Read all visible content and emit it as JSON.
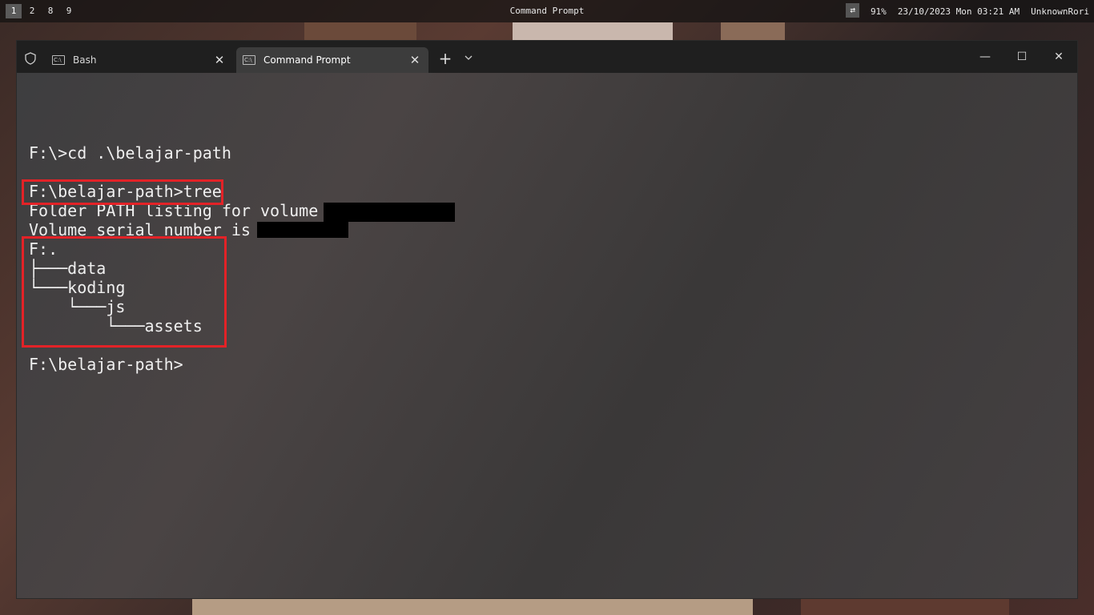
{
  "topbar": {
    "workspaces": [
      "1",
      "2",
      "8",
      "9"
    ],
    "active_workspace": "1",
    "title": "Command Prompt",
    "network_icon": "⇄",
    "battery": "91%",
    "datetime": "23/10/2023 Mon 03:21 AM",
    "user": "UnknownRori"
  },
  "terminal": {
    "tabs": [
      {
        "label": "Bash",
        "icon": "cmd-icon",
        "close": "✕",
        "active": false
      },
      {
        "label": "Command Prompt",
        "icon": "cmd-icon",
        "close": "✕",
        "active": true
      }
    ],
    "new_tab": "+",
    "tab_icon_text": "C:\\",
    "window_controls": {
      "minimize": "—",
      "maximize": "☐",
      "close": "✕"
    },
    "highlight_color": "#e32227",
    "lines": [
      "F:\\>cd .\\belajar-path",
      "F:\\belajar-path>tree",
      "Folder PATH listing for volume",
      "Volume serial number is",
      "F:.",
      "├───data",
      "└───koding",
      "    └───js",
      "        └───assets",
      "F:\\belajar-path>"
    ]
  }
}
